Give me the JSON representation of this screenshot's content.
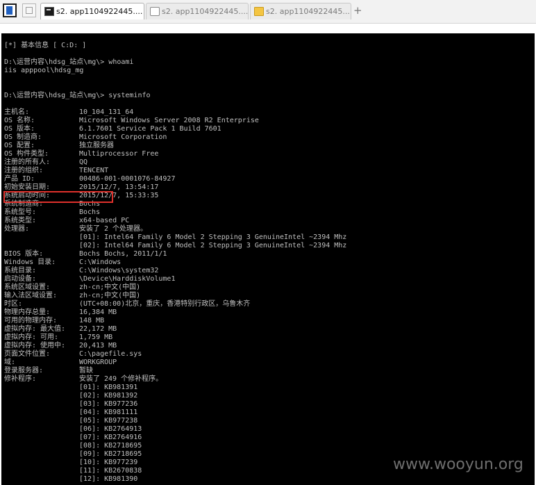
{
  "tabbar": {
    "tabs": [
      {
        "label": "s2. app1104922445....",
        "icon": "cmd-icon"
      },
      {
        "label": "s2. app1104922445....",
        "icon": "page-icon"
      },
      {
        "label": "s2. app1104922445....",
        "icon": "folder-icon"
      }
    ],
    "new_tab": "+"
  },
  "console": {
    "lines": [
      {
        "text": "[*] 基本信息 [ C:D: ]"
      },
      {
        "text": "D:\\运营内容\\hdsg_站点\\mg\\> whoami"
      },
      {
        "text": "iis apppool\\hdsg_mg"
      },
      {
        "text": "D:\\运营内容\\hdsg_站点\\mg\\> systeminfo"
      },
      {
        "key": "主机名:",
        "value": "10_104_131_64"
      },
      {
        "key": "OS 名称:",
        "value": "Microsoft Windows Server 2008 R2 Enterprise"
      },
      {
        "key": "OS 版本:",
        "value": "6.1.7601 Service Pack 1 Build 7601"
      },
      {
        "key": "OS 制造商:",
        "value": "Microsoft Corporation"
      },
      {
        "key": "OS 配置:",
        "value": "独立服务器"
      },
      {
        "key": "OS 构件类型:",
        "value": "Multiprocessor Free"
      },
      {
        "key": "注册的所有人:",
        "value": "QQ"
      },
      {
        "key": "注册的组织:",
        "value": "TENCENT"
      },
      {
        "key": "产品 ID:",
        "value": "00486-001-0001076-84927"
      },
      {
        "key": "初始安装日期:",
        "value": "2015/12/7, 13:54:17"
      },
      {
        "key": "系统启动时间:",
        "value": "2015/12/7, 15:33:35"
      },
      {
        "key": "系统制造商:",
        "value": "Bochs"
      },
      {
        "key": "系统型号:",
        "value": "Bochs"
      },
      {
        "key": "系统类型:",
        "value": "x64-based PC"
      },
      {
        "key": "处理器:",
        "value": "安装了 2 个处理器。"
      },
      {
        "value": "[01]: Intel64 Family 6 Model 2 Stepping 3 GenuineIntel ~2394 Mhz"
      },
      {
        "value": "[02]: Intel64 Family 6 Model 2 Stepping 3 GenuineIntel ~2394 Mhz"
      },
      {
        "key": "BIOS 版本:",
        "value": "Bochs Bochs, 2011/1/1"
      },
      {
        "key": "Windows 目录:",
        "value": "C:\\Windows"
      },
      {
        "key": "系统目录:",
        "value": "C:\\Windows\\system32"
      },
      {
        "key": "启动设备:",
        "value": "\\Device\\HarddiskVolume1"
      },
      {
        "key": "系统区域设置:",
        "value": "zh-cn;中文(中国)"
      },
      {
        "key": "输入法区域设置:",
        "value": "zh-cn;中文(中国)"
      },
      {
        "key": "时区:",
        "value": "(UTC+08:00)北京，重庆，香港特别行政区，乌鲁木齐"
      },
      {
        "key": "物理内存总量:",
        "value": "16,384 MB"
      },
      {
        "key": "可用的物理内存:",
        "value": "148 MB"
      },
      {
        "key": "虚拟内存: 最大值:",
        "value": "22,172 MB"
      },
      {
        "key": "虚拟内存: 可用:",
        "value": "1,759 MB"
      },
      {
        "key": "虚拟内存: 使用中:",
        "value": "20,413 MB"
      },
      {
        "key": "页面文件位置:",
        "value": "C:\\pagefile.sys"
      },
      {
        "key": "域:",
        "value": "WORKGROUP"
      },
      {
        "key": "登录服务器:",
        "value": "暂缺"
      },
      {
        "key": "修补程序:",
        "value": "安装了 249 个修补程序。"
      },
      {
        "value": "[01]: KB981391"
      },
      {
        "value": "[02]: KB981392"
      },
      {
        "value": "[03]: KB977236"
      },
      {
        "value": "[04]: KB981111"
      },
      {
        "value": "[05]: KB977238"
      },
      {
        "value": "[06]: KB2764913"
      },
      {
        "value": "[07]: KB2764916"
      },
      {
        "value": "[08]: KB2718695"
      },
      {
        "value": "[09]: KB2718695"
      },
      {
        "value": "[10]: KB977239"
      },
      {
        "value": "[11]: KB2670838"
      },
      {
        "value": "[12]: KB981390"
      }
    ]
  },
  "watermark": "www.wooyun.org",
  "colors": {
    "console_bg": "#000000",
    "console_text": "#c0c0c0",
    "highlight_box": "#e0312c"
  }
}
